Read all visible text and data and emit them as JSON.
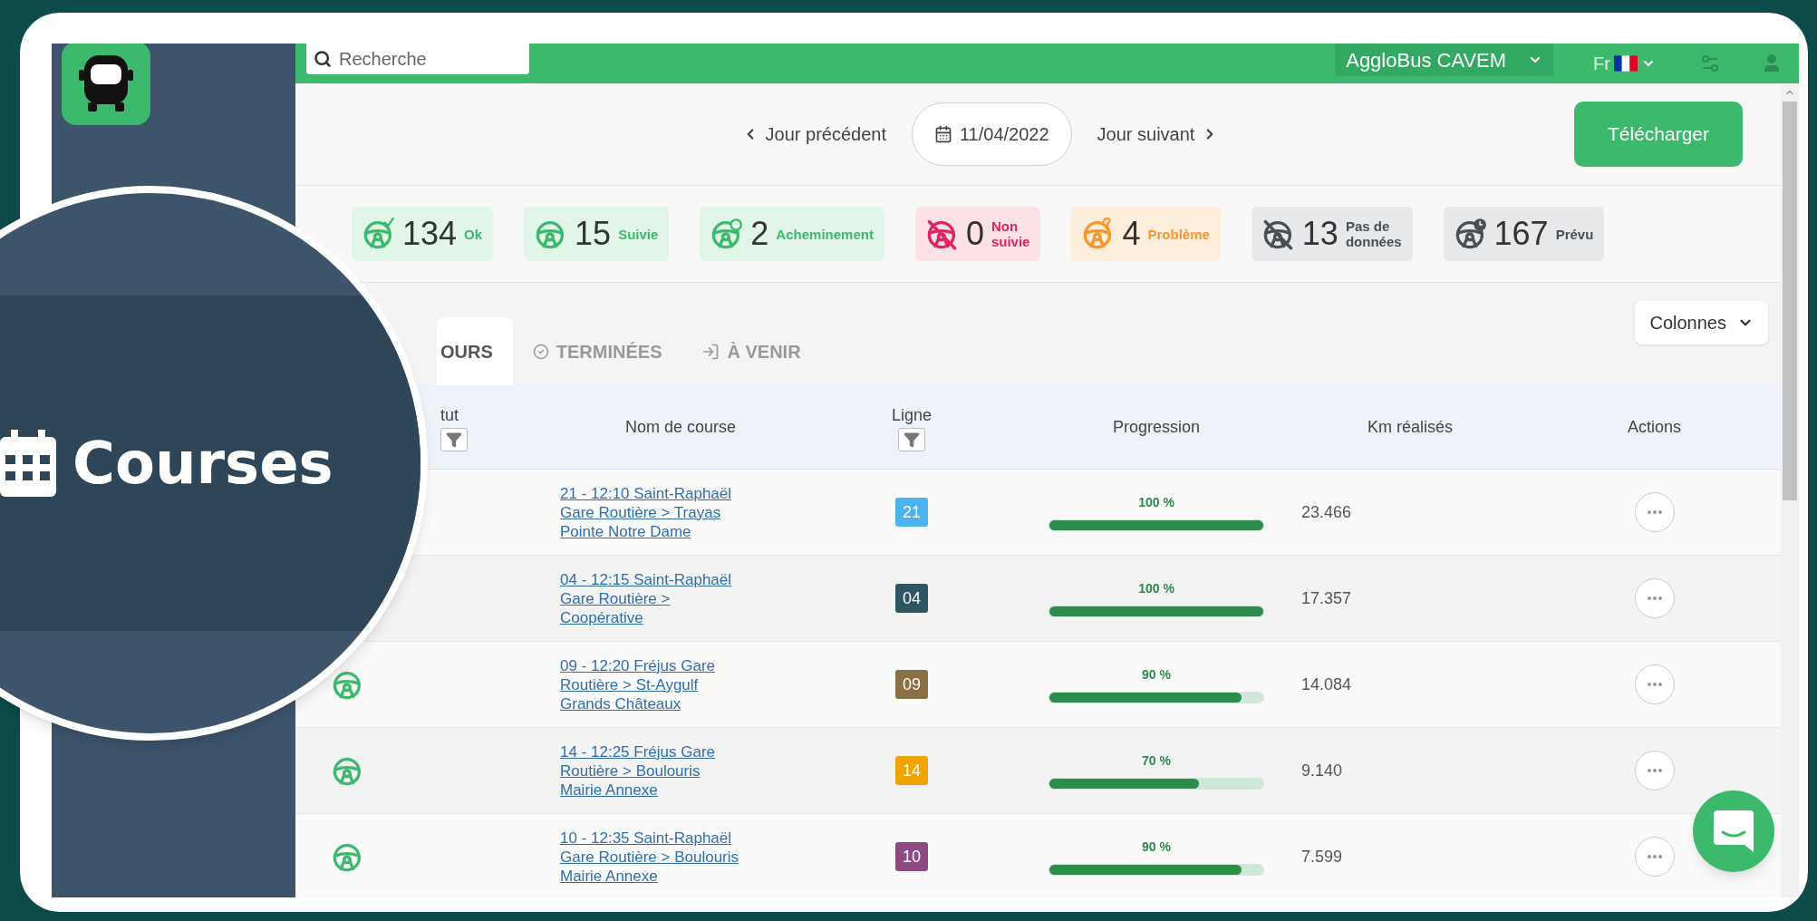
{
  "magnifier": {
    "label": "Courses"
  },
  "topbar": {
    "search": {
      "placeholder": "Recherche"
    },
    "network": "AggloBus CAVEM",
    "language": "Fr"
  },
  "date_nav": {
    "previous": "Jour précédent",
    "date": "11/04/2022",
    "next": "Jour suivant",
    "download": "Télécharger"
  },
  "stats": [
    {
      "kind": "ok",
      "count": "134",
      "label": "Ok"
    },
    {
      "kind": "tracked",
      "count": "15",
      "label": "Suivie"
    },
    {
      "kind": "routing",
      "count": "2",
      "label": "Acheminement"
    },
    {
      "kind": "untracked",
      "count": "0",
      "label": "Non suivie"
    },
    {
      "kind": "problem",
      "count": "4",
      "label": "Problème"
    },
    {
      "kind": "nodata",
      "count": "13",
      "label": "Pas de données"
    },
    {
      "kind": "planned",
      "count": "167",
      "label": "Prévu"
    }
  ],
  "tabs": [
    {
      "kind": "current",
      "label": "OURS",
      "selected": true
    },
    {
      "kind": "done",
      "label": "TERMINÉES",
      "selected": false
    },
    {
      "kind": "upcoming",
      "label": "À VENIR",
      "selected": false
    }
  ],
  "columns_button": "Colonnes",
  "table": {
    "columns": [
      {
        "label": "tut",
        "filter": true
      },
      {
        "label": "Nom de course",
        "filter": false
      },
      {
        "label": "Ligne",
        "filter": true
      },
      {
        "label": "Progression",
        "filter": false
      },
      {
        "label": "Km réalisés",
        "filter": false
      },
      {
        "label": "Actions",
        "filter": false
      }
    ],
    "rows": [
      {
        "name": "21 - 12:10 Saint-Raphaël Gare Routière > Trayas Pointe Notre Dame",
        "line": "21",
        "color": "#4db3ef",
        "progress": "100 %",
        "level": 1,
        "km": "23.466"
      },
      {
        "name": "04 - 12:15 Saint-Raphaël Gare Routière > Coopérative",
        "line": "04",
        "color": "#2f5563",
        "progress": "100 %",
        "level": 1,
        "km": "17.357"
      },
      {
        "kind": "tracked",
        "name": "09 - 12:20 Fréjus Gare Routière > St-Aygulf Grands Châteaux",
        "line": "09",
        "color": "#8b6f47",
        "progress": "90 %",
        "level": 0.9,
        "km": "14.084"
      },
      {
        "kind": "tracked",
        "name": "14 - 12:25 Fréjus Gare Routière > Boulouris Mairie Annexe",
        "line": "14",
        "color": "#f0a400",
        "progress": "70 %",
        "level": 0.7,
        "km": "9.140"
      },
      {
        "kind": "tracked",
        "name": "10 - 12:35 Saint-Raphaël Gare Routière > Boulouris Mairie Annexe",
        "line": "10",
        "color": "#8e4a85",
        "progress": "90 %",
        "level": 0.9,
        "km": "7.599"
      }
    ]
  }
}
